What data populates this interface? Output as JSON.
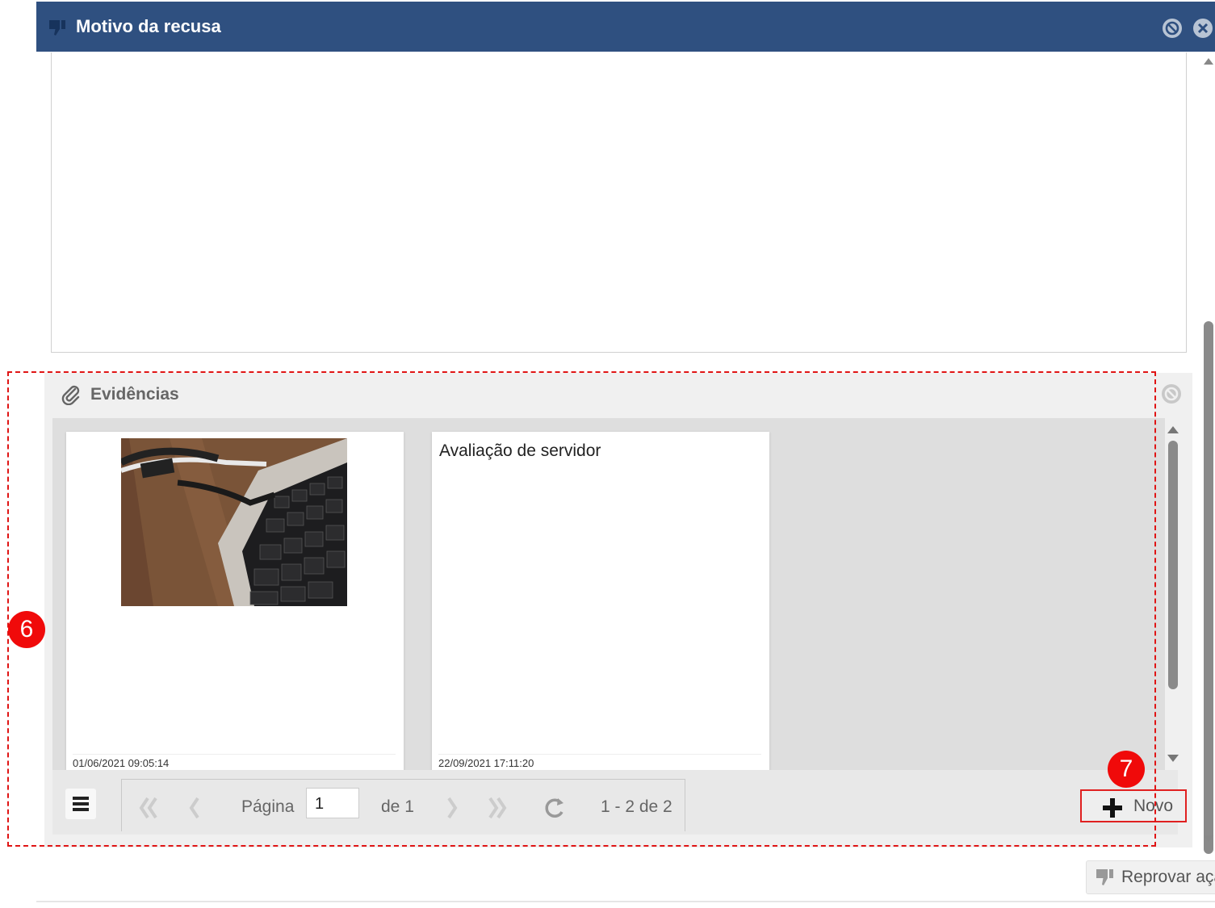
{
  "dialog": {
    "title": "Motivo da recusa",
    "title_icon": "thumbs-down-icon",
    "header_color": "#2f5080"
  },
  "evidences": {
    "title": "Evidências",
    "icon": "paperclip-icon",
    "cards": [
      {
        "type": "image",
        "image_desc": "laptop-keyboard-photo",
        "timestamp": "01/06/2021 09:05:14"
      },
      {
        "type": "text",
        "title": "Avaliação de servidor",
        "timestamp": "22/09/2021 17:11:20"
      }
    ],
    "pager": {
      "page_label": "Página",
      "page_value": "1",
      "of_label": "de 1",
      "range_label": "1 - 2 de 2"
    },
    "new_button_label": "Novo"
  },
  "markers": {
    "six": "6",
    "seven": "7"
  },
  "footer": {
    "reject_label": "Reprovar ação"
  },
  "accent_colors": {
    "annotation": "#e01515"
  }
}
